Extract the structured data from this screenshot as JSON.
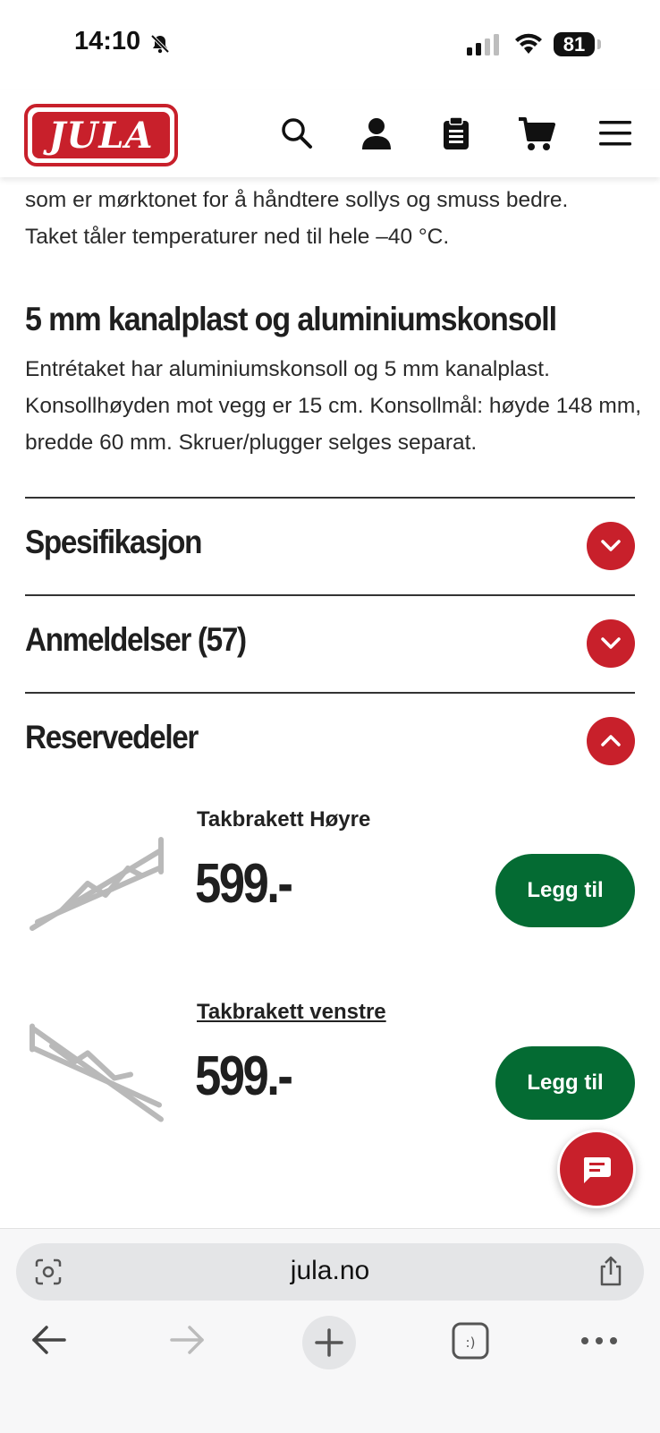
{
  "status_bar": {
    "time": "14:10",
    "battery": "81",
    "battery_level": 0.81
  },
  "header": {
    "logo_text": "JULA"
  },
  "content": {
    "intro_line1": "som er mørktonet for å håndtere sollys og smuss bedre.",
    "intro_line2": "Taket tåler temperaturer ned til hele –40 °C.",
    "section_title": "5 mm kanalplast og aluminiumskonsoll",
    "section_text": "Entrétaket har aluminiumskonsoll og 5 mm kanalplast. Konsollhøyden mot vegg er 15 cm. Konsollmål: høyde 148 mm, bredde 60 mm. Skruer/plugger selges separat."
  },
  "accordions": [
    {
      "title": "Spesifikasjon",
      "expanded": false
    },
    {
      "title": "Anmeldelser (57)",
      "expanded": false
    },
    {
      "title": "Reservedeler",
      "expanded": true
    }
  ],
  "spare_parts": [
    {
      "name": "Takbrakett Høyre",
      "price": "599.-",
      "button": "Legg til"
    },
    {
      "name": "Takbrakett venstre",
      "price": "599.-",
      "button": "Legg til"
    }
  ],
  "browser": {
    "url": "jula.no"
  },
  "colors": {
    "brand_red": "#c8202b",
    "button_green": "#046b33",
    "text_dark": "#1f1f1f"
  },
  "icons": [
    "bell-slash-icon",
    "signal-icon",
    "wifi-icon",
    "search-icon",
    "user-icon",
    "clipboard-icon",
    "cart-icon",
    "menu-icon",
    "chevron-down-icon",
    "chevron-up-icon",
    "chat-icon",
    "lens-icon",
    "share-icon",
    "back-icon",
    "forward-icon",
    "plus-icon",
    "tabs-icon",
    "more-icon"
  ]
}
